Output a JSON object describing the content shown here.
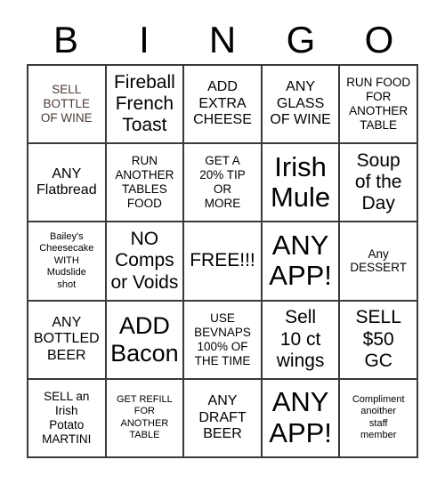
{
  "header": {
    "letters": [
      "B",
      "I",
      "N",
      "G",
      "O"
    ]
  },
  "colors": {
    "grid_line": "#3a3a3a",
    "text": "#000000",
    "wine_text": "#4c3a34",
    "background": "#ffffff"
  },
  "grid": {
    "rows": 5,
    "columns": 5,
    "cells": [
      {
        "text": "SELL\nBOTTLE\nOF WINE",
        "size": "s",
        "tint": "wine"
      },
      {
        "text": "Fireball\nFrench\nToast",
        "size": "l",
        "tint": "none"
      },
      {
        "text": "ADD\nEXTRA\nCHEESE",
        "size": "m",
        "tint": "none"
      },
      {
        "text": "ANY\nGLASS\nOF WINE",
        "size": "m",
        "tint": "none"
      },
      {
        "text": "RUN FOOD\nFOR\nANOTHER\nTABLE",
        "size": "s",
        "tint": "none"
      },
      {
        "text": "ANY\nFlatbread",
        "size": "m",
        "tint": "none"
      },
      {
        "text": "RUN\nANOTHER\nTABLES\nFOOD",
        "size": "s",
        "tint": "none"
      },
      {
        "text": "GET A\n20% TIP\nOR\nMORE",
        "size": "s",
        "tint": "none"
      },
      {
        "text": "Irish\nMule",
        "size": "xxl",
        "tint": "none"
      },
      {
        "text": "Soup\nof the\nDay",
        "size": "l",
        "tint": "none"
      },
      {
        "text": "Bailey's\nCheesecake\nWITH\nMudslide\nshot",
        "size": "xs",
        "tint": "none"
      },
      {
        "text": "NO\nComps\nor Voids",
        "size": "l",
        "tint": "none"
      },
      {
        "text": "FREE!!!",
        "size": "l",
        "tint": "none"
      },
      {
        "text": "ANY\nAPP!",
        "size": "xxl",
        "tint": "none"
      },
      {
        "text": "Any\nDESSERT",
        "size": "s",
        "tint": "none"
      },
      {
        "text": "ANY\nBOTTLED\nBEER",
        "size": "m",
        "tint": "none"
      },
      {
        "text": "ADD\nBacon",
        "size": "xl",
        "tint": "none"
      },
      {
        "text": "USE\nBEVNAPS\n100% OF\nTHE TIME",
        "size": "s",
        "tint": "none"
      },
      {
        "text": "Sell\n10 ct\nwings",
        "size": "l",
        "tint": "none"
      },
      {
        "text": "SELL\n$50\nGC",
        "size": "l",
        "tint": "none"
      },
      {
        "text": "SELL an\nIrish\nPotato\nMARTINI",
        "size": "s",
        "tint": "none"
      },
      {
        "text": "GET REFILL\nFOR\nANOTHER\nTABLE",
        "size": "xs",
        "tint": "none"
      },
      {
        "text": "ANY\nDRAFT\nBEER",
        "size": "m",
        "tint": "none"
      },
      {
        "text": "ANY\nAPP!",
        "size": "xxl",
        "tint": "none"
      },
      {
        "text": "Compliment\nanoither\nstaff\nmember",
        "size": "xs",
        "tint": "none"
      }
    ]
  }
}
